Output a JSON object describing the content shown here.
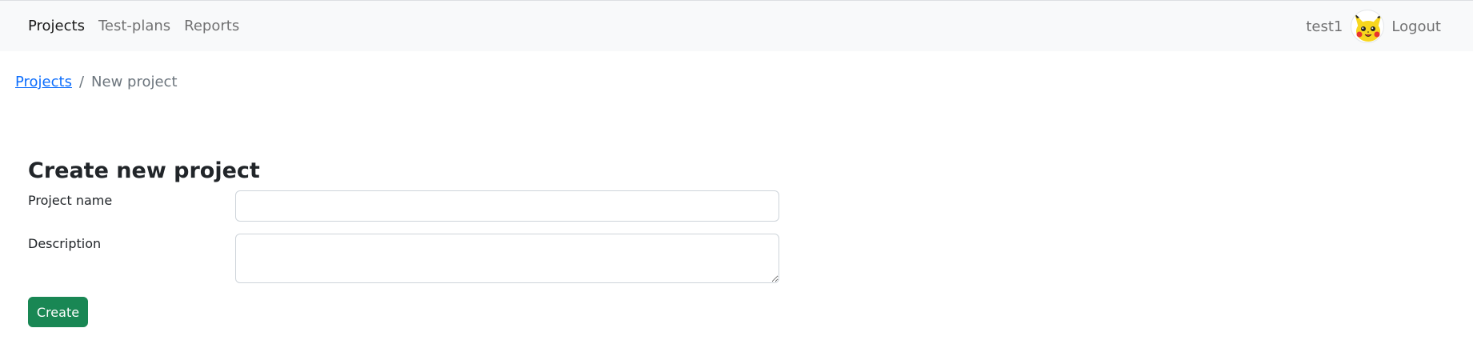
{
  "navbar": {
    "links": [
      {
        "label": "Projects",
        "active": true
      },
      {
        "label": "Test-plans",
        "active": false
      },
      {
        "label": "Reports",
        "active": false
      }
    ],
    "username": "test1",
    "avatar_icon": "pikachu-avatar",
    "logout_label": "Logout"
  },
  "breadcrumb": {
    "link_label": "Projects",
    "separator": "/",
    "current": "New project"
  },
  "form": {
    "title": "Create new project",
    "name_label": "Project name",
    "name_value": "",
    "description_label": "Description",
    "description_value": "",
    "submit_label": "Create"
  },
  "colors": {
    "navbar_bg": "#f8f9fa",
    "link_blue": "#0d6efd",
    "create_green": "#198754"
  }
}
